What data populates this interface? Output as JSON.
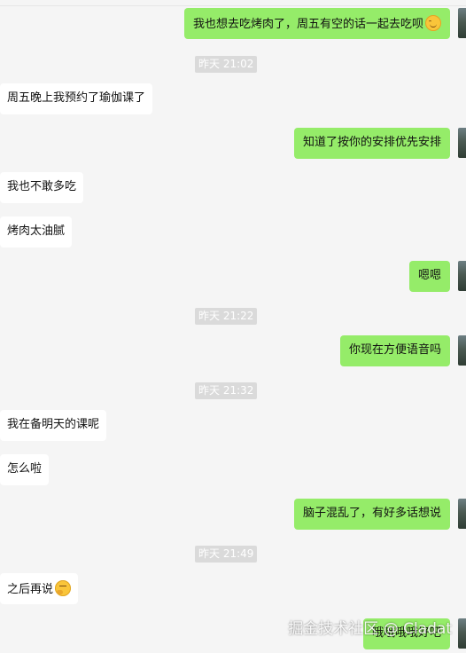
{
  "chat": {
    "messages": [
      {
        "side": "right",
        "text": "我也想去吃烤肉了，周五有空的话一起去吃呗",
        "emoji": "smile-emoji"
      },
      {
        "type": "time",
        "text": "昨天 21:02"
      },
      {
        "side": "left",
        "text": "周五晚上我预约了瑜伽课了"
      },
      {
        "side": "right",
        "text": "知道了按你的安排优先安排"
      },
      {
        "side": "left",
        "text": "我也不敢多吃"
      },
      {
        "side": "left",
        "text": "烤肉太油腻"
      },
      {
        "side": "right",
        "text": "嗯嗯"
      },
      {
        "type": "time",
        "text": "昨天 21:22"
      },
      {
        "side": "right",
        "text": "你现在方便语音吗"
      },
      {
        "type": "time",
        "text": "昨天 21:32"
      },
      {
        "side": "left",
        "text": "我在备明天的课呢"
      },
      {
        "side": "left",
        "text": "怎么啦"
      },
      {
        "side": "right",
        "text": "脑子混乱了，有好多话想说"
      },
      {
        "type": "time",
        "text": "昨天 21:49"
      },
      {
        "side": "left",
        "text": "之后再说",
        "emoji": "thinking-emoji"
      },
      {
        "side": "right",
        "text": "哦哦哦哦好吧"
      }
    ]
  },
  "watermark": {
    "text": "掘金技术社区 @ Cladat"
  },
  "colors": {
    "background": "#f5f5f5",
    "sent_bubble": "#95ec69",
    "received_bubble": "#ffffff",
    "timestamp_badge": "#dadada"
  }
}
